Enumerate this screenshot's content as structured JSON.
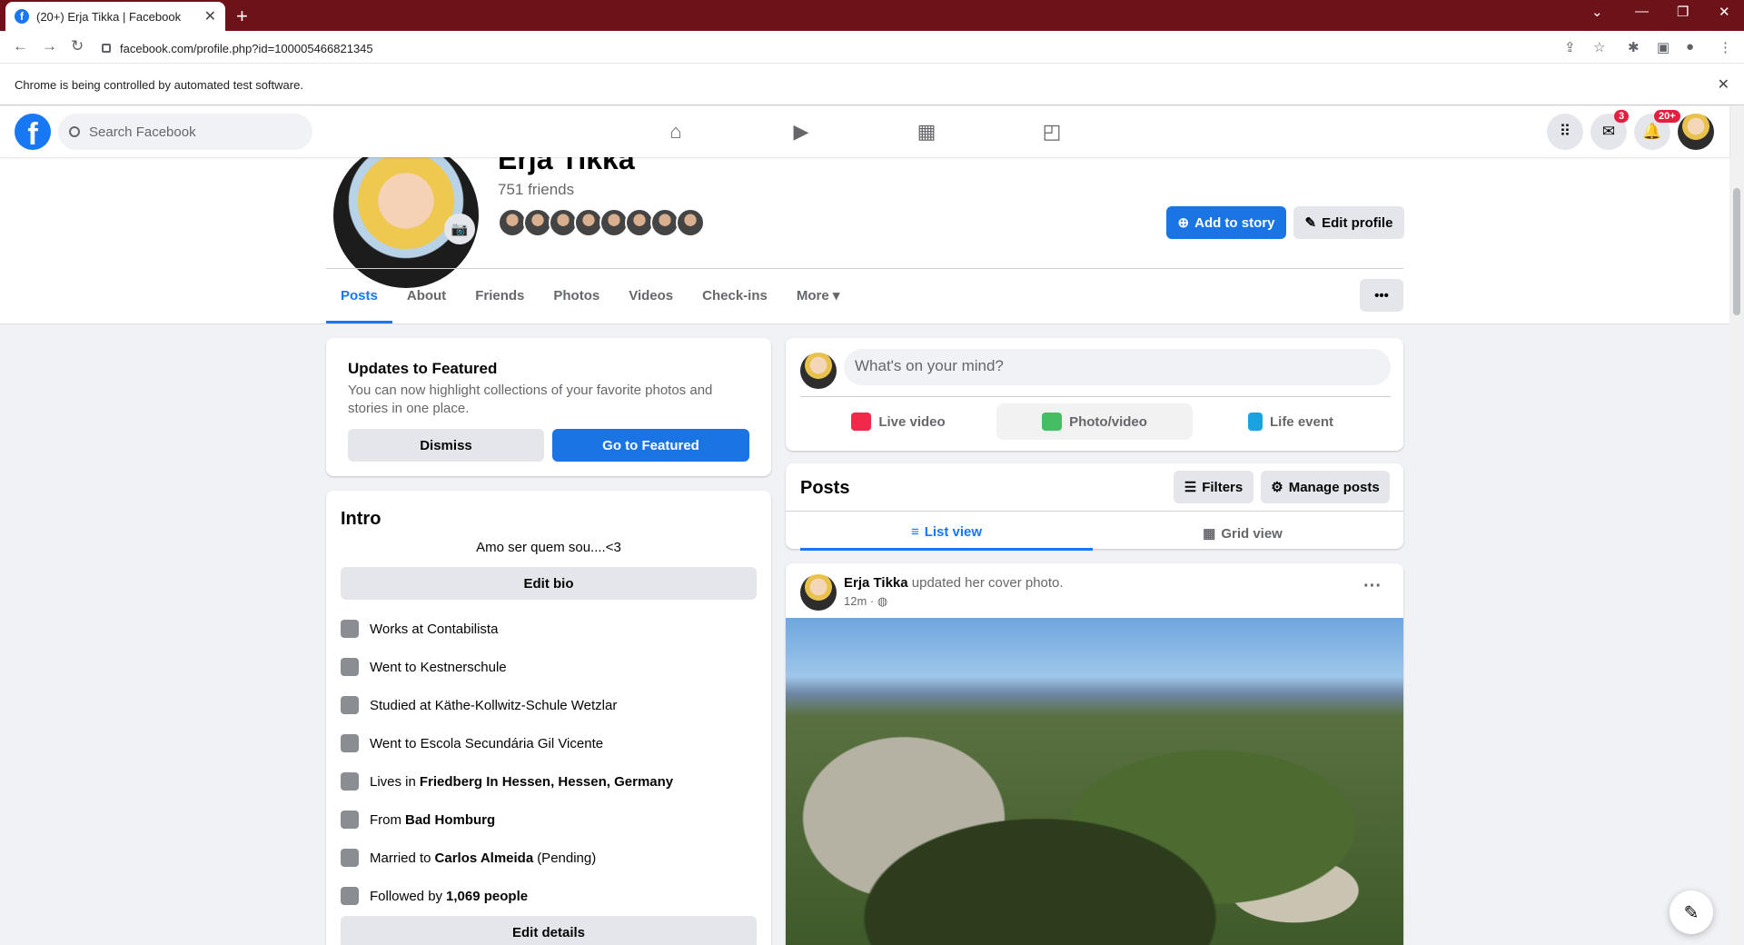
{
  "browser": {
    "tab_title": "(20+) Erja Tikka | Facebook",
    "url": "facebook.com/profile.php?id=100005466821345",
    "infobar_text": "Chrome is being controlled by automated test software."
  },
  "header": {
    "search_placeholder": "Search Facebook",
    "messenger_badge": "3",
    "notifications_badge": "20+"
  },
  "profile": {
    "name": "Erja Tikka",
    "friends_count": "751 friends",
    "add_story_label": "Add to story",
    "edit_profile_label": "Edit profile",
    "tabs": [
      "Posts",
      "About",
      "Friends",
      "Photos",
      "Videos",
      "Check-ins",
      "More"
    ]
  },
  "featured": {
    "title": "Updates to Featured",
    "text": "You can now highlight collections of your favorite photos and stories in one place.",
    "dismiss_label": "Dismiss",
    "go_label": "Go to Featured"
  },
  "intro": {
    "title": "Intro",
    "bio": "Amo ser quem sou....<3",
    "edit_bio_label": "Edit bio",
    "items": [
      {
        "prefix": "Works at Contabilista",
        "bold": "",
        "suffix": ""
      },
      {
        "prefix": "Went to Kestnerschule",
        "bold": "",
        "suffix": ""
      },
      {
        "prefix": "Studied at Käthe-Kollwitz-Schule Wetzlar",
        "bold": "",
        "suffix": ""
      },
      {
        "prefix": "Went to Escola Secundária Gil Vicente",
        "bold": "",
        "suffix": ""
      },
      {
        "prefix": "Lives in",
        "bold": "Friedberg In Hessen, Hessen, Germany",
        "suffix": ""
      },
      {
        "prefix": "From",
        "bold": "Bad Homburg",
        "suffix": ""
      },
      {
        "prefix": "Married to",
        "bold": "Carlos Almeida",
        "suffix": "(Pending)"
      },
      {
        "prefix": "Followed by",
        "bold": "1,069 people",
        "suffix": ""
      }
    ],
    "edit_details_label": "Edit details"
  },
  "composer": {
    "placeholder": "What's on your mind?",
    "live_video": "Live video",
    "photo_video": "Photo/video",
    "life_event": "Life event"
  },
  "posts": {
    "title": "Posts",
    "filters_label": "Filters",
    "manage_label": "Manage posts",
    "list_view": "List view",
    "grid_view": "Grid view"
  },
  "post": {
    "author": "Erja Tikka",
    "action": "updated her cover photo.",
    "time": "12m ·"
  },
  "colors": {
    "accent": "#1877f2",
    "tabstrip": "#6e1219",
    "badge": "#e41e3f"
  }
}
